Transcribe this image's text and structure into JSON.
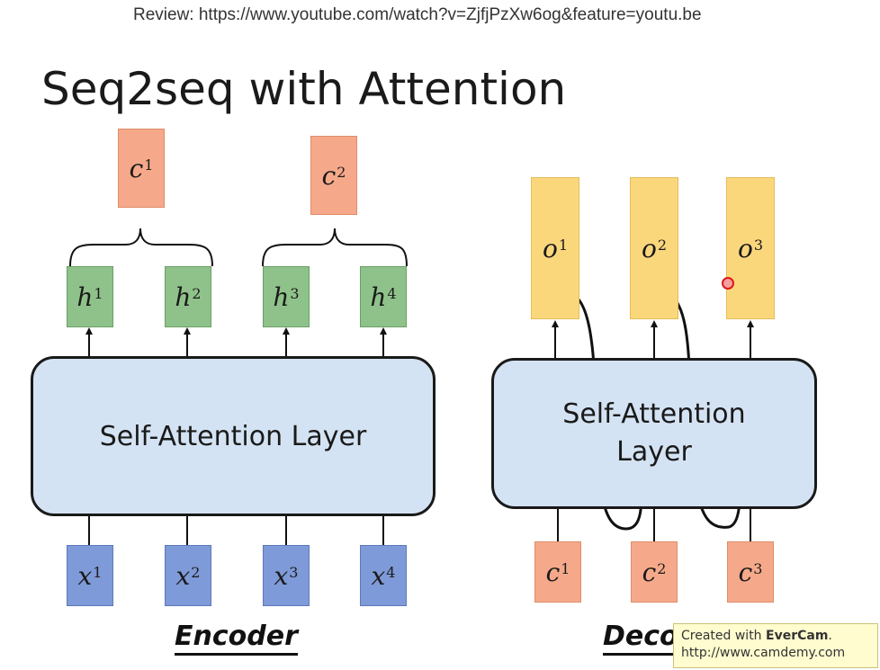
{
  "header": {
    "review_text": "Review: https://www.youtube.com/watch?v=ZjfjPzXw6og&feature=youtu.be"
  },
  "slide": {
    "title": "Seq2seq with Attention"
  },
  "encoder": {
    "label": "Encoder",
    "layer_label": "Self-Attention Layer",
    "contexts": [
      {
        "base": "c",
        "sup": "1"
      },
      {
        "base": "c",
        "sup": "2"
      }
    ],
    "hidden": [
      {
        "base": "h",
        "sup": "1"
      },
      {
        "base": "h",
        "sup": "2"
      },
      {
        "base": "h",
        "sup": "3"
      },
      {
        "base": "h",
        "sup": "4"
      }
    ],
    "inputs": [
      {
        "base": "x",
        "sup": "1"
      },
      {
        "base": "x",
        "sup": "2"
      },
      {
        "base": "x",
        "sup": "3"
      },
      {
        "base": "x",
        "sup": "4"
      }
    ]
  },
  "decoder": {
    "label": "Decoder",
    "layer_label_line1": "Self-Attention",
    "layer_label_line2": "Layer",
    "outputs": [
      {
        "base": "o",
        "sup": "1"
      },
      {
        "base": "o",
        "sup": "2"
      },
      {
        "base": "o",
        "sup": "3"
      }
    ],
    "inputs": [
      {
        "base": "c",
        "sup": "1"
      },
      {
        "base": "c",
        "sup": "2"
      },
      {
        "base": "c",
        "sup": "3"
      }
    ]
  },
  "watermark": {
    "line1_prefix": "Created with ",
    "line1_brand": "EverCam",
    "line1_suffix": ".",
    "line2": "http://www.camdemy.com"
  },
  "colors": {
    "context": "#f5a98a",
    "hidden": "#8fc28a",
    "input": "#7f9ad8",
    "output": "#fbd77c",
    "layer": "#d4e3f3"
  }
}
